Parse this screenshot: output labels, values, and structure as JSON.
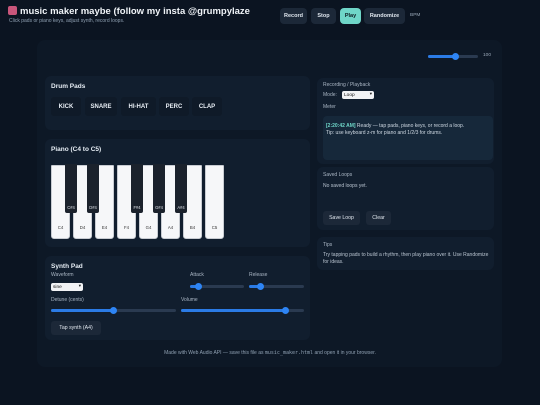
{
  "header": {
    "title": "music maker maybe (follow my insta @grumpylaze",
    "subtitle": "Click pads or piano keys, adjust synth, record loops.",
    "buttons": {
      "record": "Record",
      "stop": "Stop",
      "play": "Play",
      "randomize": "Randomize"
    },
    "bpm_label": "BPM",
    "bpm_value": "100",
    "bpm_level": 0.55
  },
  "drum_pads": {
    "title": "Drum Pads",
    "pads": [
      "KICK",
      "SNARE",
      "HI-HAT",
      "PERC",
      "CLAP"
    ]
  },
  "piano": {
    "title": "Piano (C4 to C5)",
    "white_keys": [
      "C4",
      "D4",
      "E4",
      "F4",
      "G4",
      "A4",
      "B4",
      "C5"
    ],
    "black_keys": [
      "C#4",
      "D#4",
      "F#4",
      "G#4",
      "A#4"
    ]
  },
  "synth": {
    "title": "Synth Pad",
    "waveform_label": "Waveform",
    "waveform_value": "sine",
    "attack_label": "Attack",
    "attack_level": 0.15,
    "release_label": "Release",
    "release_level": 0.2,
    "detune_label": "Detune (cents)",
    "detune_level": 0.5,
    "volume_label": "Volume",
    "volume_level": 0.85,
    "tap_button": "Tap synth (A4)"
  },
  "recording": {
    "title": "Recording / Playback",
    "mode_label": "Mode:",
    "mode_value": "Loop",
    "meter_label": "Meter",
    "log_time": "[2:20:42 AM]",
    "log_text": " Ready — tap pads, piano keys, or record a loop.",
    "log_tip": "Tip: use keyboard z-m for piano and 1/2/3 for drums."
  },
  "saved_loops": {
    "title": "Saved Loops",
    "empty_text": "No saved loops yet.",
    "save_button": "Save Loop",
    "clear_button": "Clear"
  },
  "tips": {
    "title": "Tips",
    "text": "Try tapping pads to build a rhythm, then play piano over it. Use Randomize for ideas."
  },
  "footer": {
    "prefix": "Made with Web Audio API — save this file as ",
    "filename": "music_maker.html",
    "suffix": " and open it in your browser."
  },
  "colors": {
    "accent": "#6fd6c8",
    "slider": "#2e85f5",
    "background": "#0b1421",
    "card": "#111e2e"
  }
}
